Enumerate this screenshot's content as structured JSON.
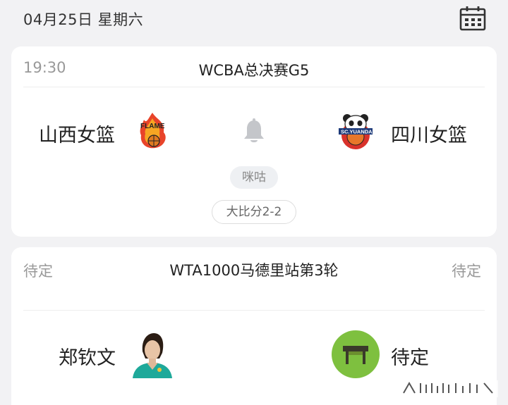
{
  "header": {
    "date": "04月25日 星期六",
    "icon": "calendar-icon"
  },
  "match1": {
    "time": "19:30",
    "title": "WCBA总决赛G5",
    "home": {
      "name": "山西女篮",
      "logo": "shanxi-flame-logo"
    },
    "away": {
      "name": "四川女篮",
      "logo": "sichuan-panda-logo"
    },
    "bell_icon": "bell-icon",
    "broadcaster": "咪咕",
    "series_score": "大比分2-2"
  },
  "match2": {
    "status_left": "待定",
    "title": "WTA1000马德里站第3轮",
    "status_right": "待定",
    "home": {
      "name": "郑钦文",
      "avatar": "player-avatar"
    },
    "away": {
      "name": "待定",
      "icon": "table-icon"
    }
  },
  "colors": {
    "background": "#f2f2f4",
    "card": "#ffffff",
    "muted": "#999999",
    "green": "#7ec03f"
  }
}
